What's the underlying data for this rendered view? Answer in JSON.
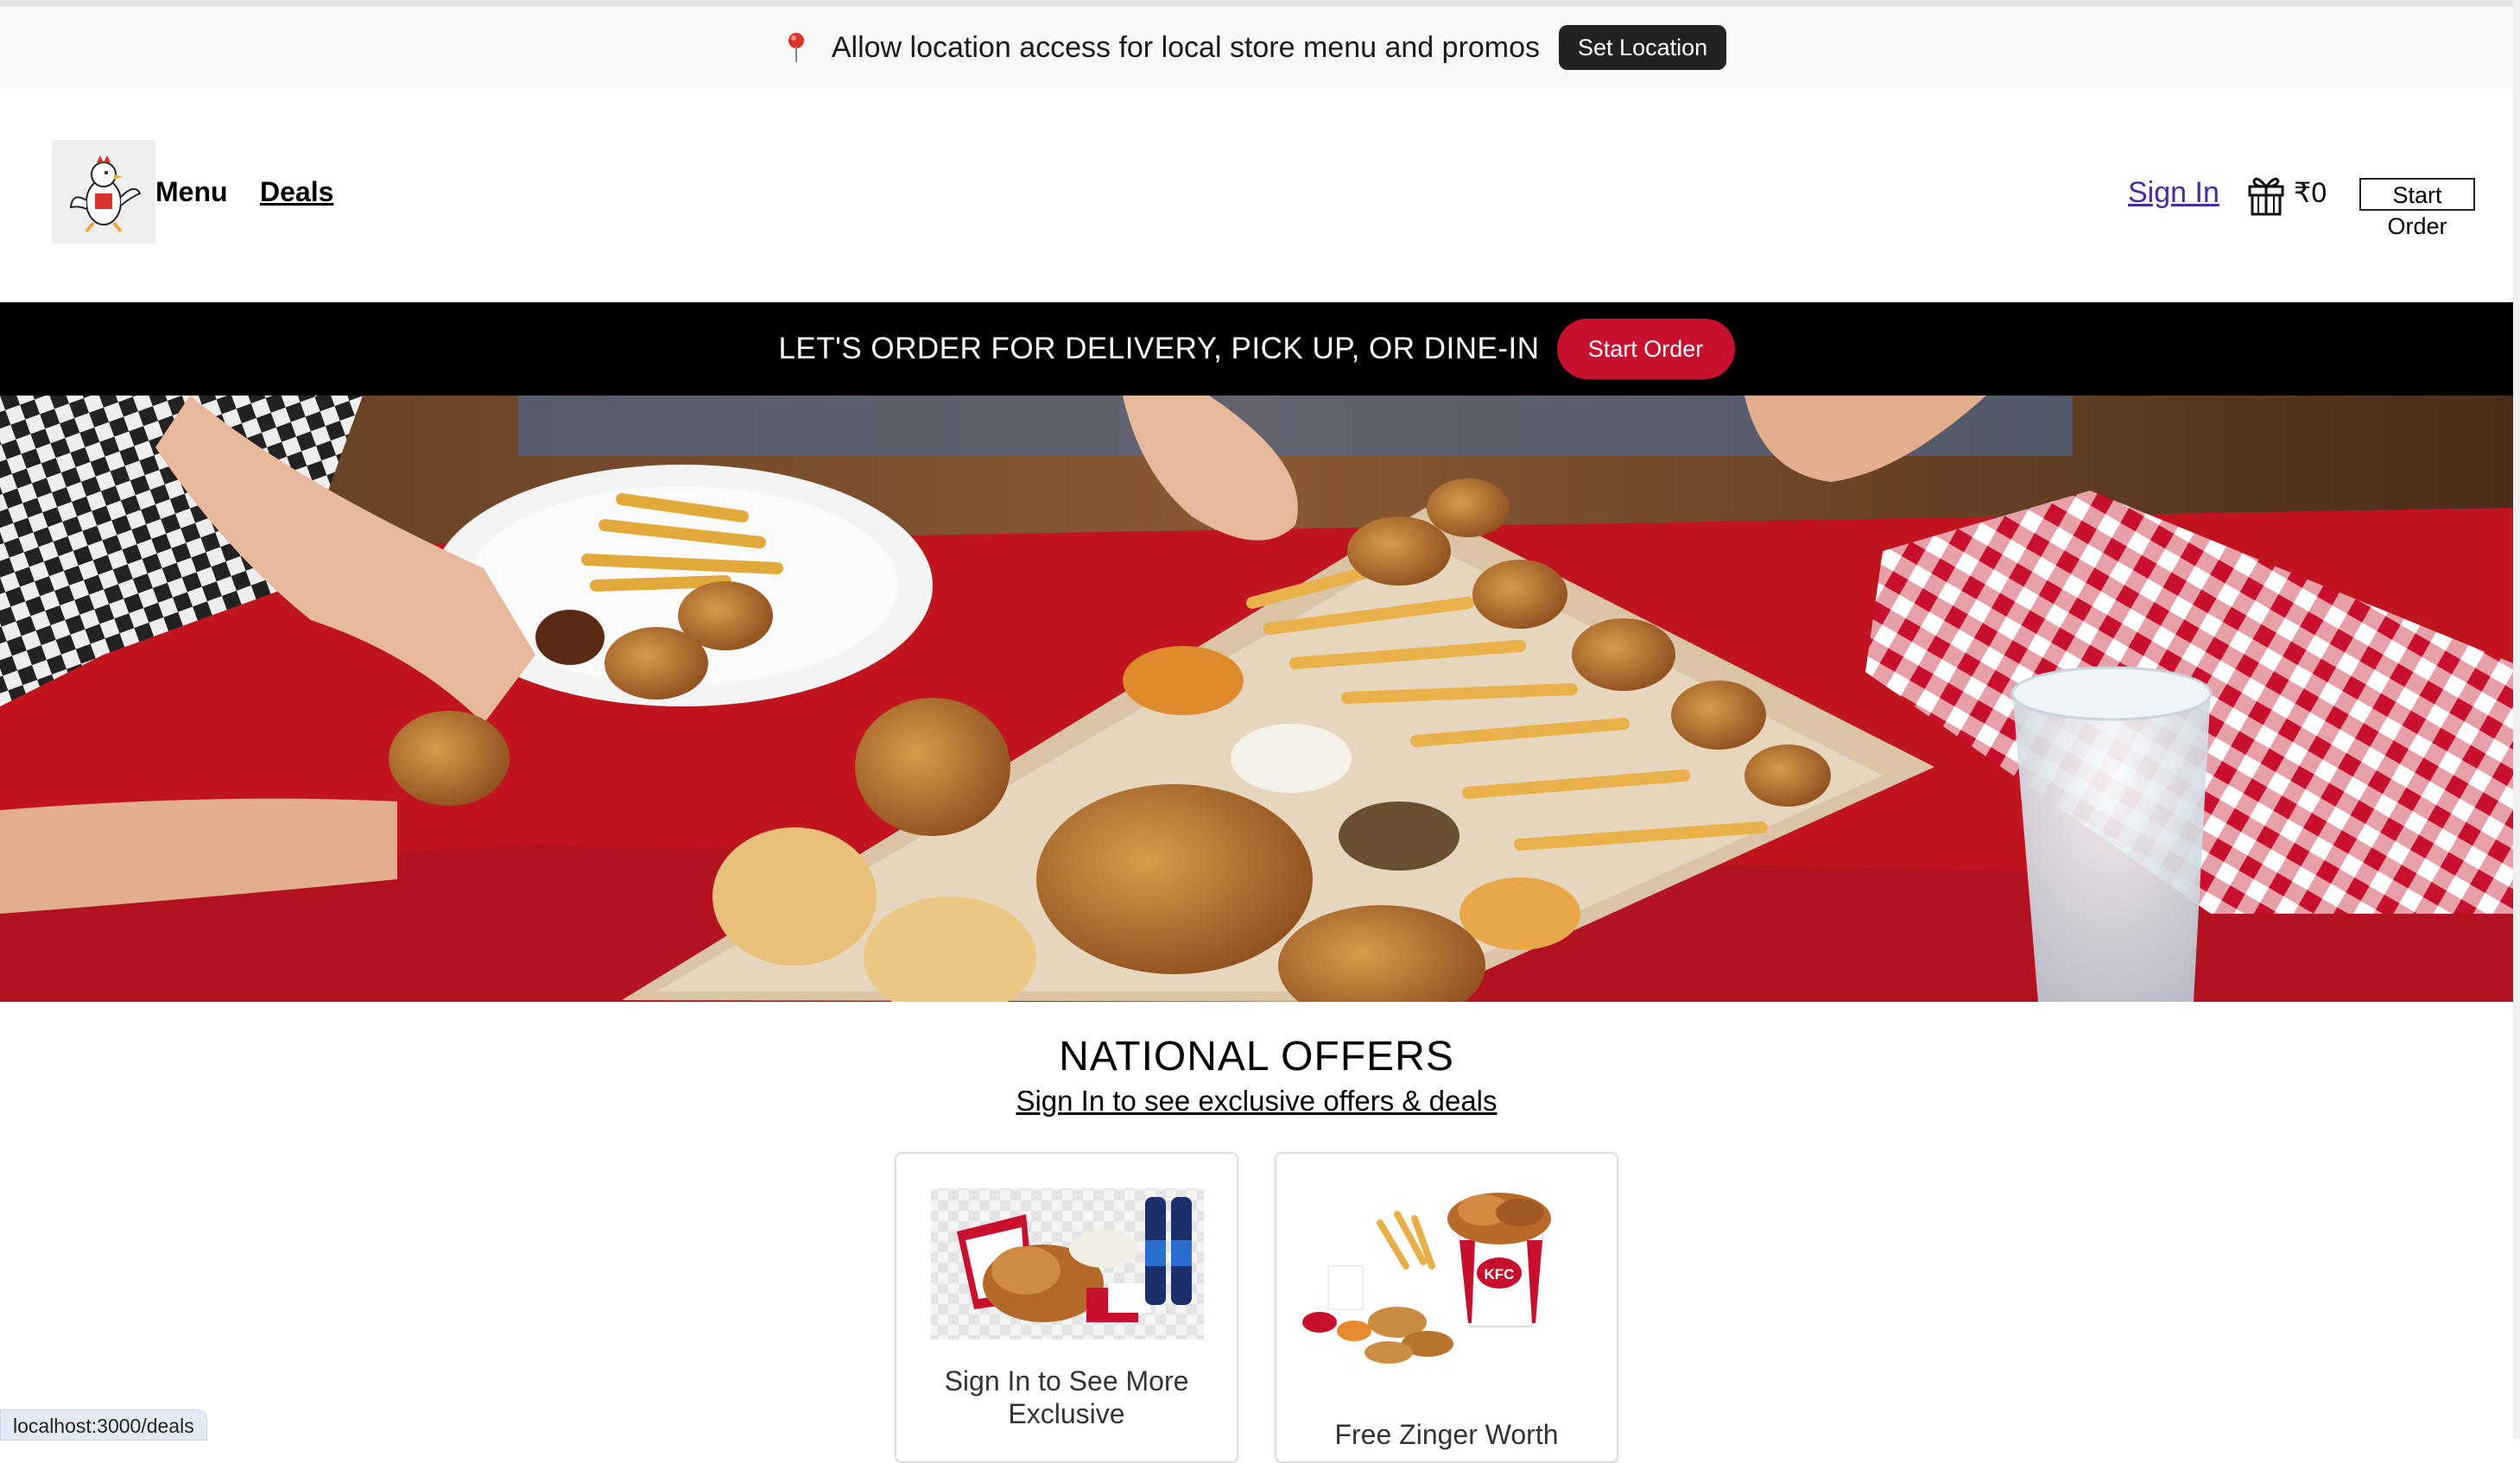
{
  "location_bar": {
    "message": "Allow location access for local store menu and promos",
    "button_label": "Set Location",
    "icon": "map-pin-icon"
  },
  "header": {
    "logo_alt": "chicken mascot logo",
    "nav": [
      {
        "label": "Menu"
      },
      {
        "label": "Deals"
      }
    ],
    "sign_in_label": "Sign In",
    "rewards_icon": "gift-icon",
    "cart_total": "₹0",
    "start_order_label": "Start Order"
  },
  "order_strip": {
    "message": "LET'S ORDER FOR DELIVERY, PICK UP, OR DINE-IN",
    "button_label": "Start Order"
  },
  "hero": {
    "image_subject": "hands reaching for fried chicken, fries and dips on a red tablecloth"
  },
  "offers": {
    "title": "NATIONAL OFFERS",
    "subtitle": "Sign In to see exclusive offers & deals",
    "cards": [
      {
        "title": "Sign In to See More Exclusive",
        "image": "bucket-meal-with-drinks"
      },
      {
        "title": "Free Zinger Worth",
        "image": "kfc-bucket-with-fries"
      }
    ]
  },
  "status_bar": {
    "url": "localhost:3000/deals"
  },
  "colors": {
    "brand_red": "#c8102e",
    "dark": "#222222",
    "link_purple": "#4b2a9b"
  }
}
